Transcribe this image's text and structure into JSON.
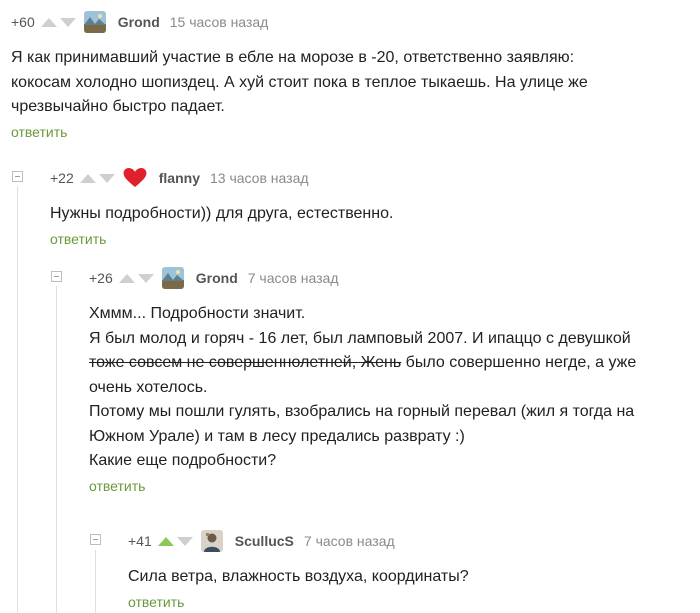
{
  "comments": [
    {
      "rating": "+60",
      "author": "Grond",
      "time": "15 часов назад",
      "avatar_icon": "landscape-avatar",
      "lines": [
        "Я как принимавший участие в ебле на морозе в -20, ответственно заявляю:",
        "кокосам холодно шопиздец. А хуй стоит пока в теплое тыкаешь. На улице же",
        "чрезвычайно быстро падает."
      ],
      "reply": "ответить"
    },
    {
      "rating": "+22",
      "author": "flanny",
      "time": "13 часов назад",
      "avatar_icon": "heart-icon",
      "lines": [
        "Нужны подробности)) для друга, естественно."
      ],
      "reply": "ответить"
    },
    {
      "rating": "+26",
      "author": "Grond",
      "time": "7 часов назад",
      "avatar_icon": "landscape-avatar",
      "lines": [
        "Хммм... Подробности значит.",
        "Я был молод и горяч - 16 лет, был ламповый 2007. И ипаццо с девушкой",
        "",
        "очень хотелось.",
        "Потому мы пошли гулять, взобрались на горный перевал (жил я тогда на",
        "Южном Урале) и там в лесу предались разврату :)",
        "Какие еще подробности?"
      ],
      "strike_text": "тоже совсем не совершеннолетней, Жень",
      "after_strike_text": " было совершенно негде, а уже",
      "reply": "ответить"
    },
    {
      "rating": "+41",
      "author": "ScullucS",
      "time": "7 часов назад",
      "avatar_icon": "person-avatar",
      "lines": [
        "Сила ветра, влажность воздуха, координаты?"
      ],
      "reply": "ответить"
    }
  ],
  "colors": {
    "vote_arrow": "#cfcfcf",
    "upvoted_arrow": "#8ac858",
    "reply_link": "#6a9a3b",
    "heart": "#e0212b"
  }
}
